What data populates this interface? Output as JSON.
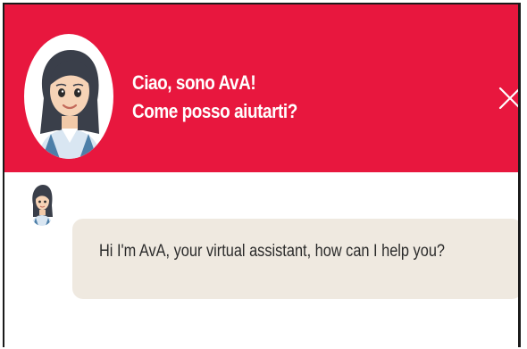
{
  "header": {
    "greeting_line1": "Ciao, sono AvA!",
    "greeting_line2": "Come posso aiutarti?",
    "background_color": "#e8173e",
    "close_icon": "close-icon"
  },
  "assistant": {
    "avatar_icon": "assistant-avatar"
  },
  "messages": [
    {
      "sender": "assistant",
      "text": "Hi I'm AvA, your virtual assistant, how can I help you?",
      "bubble_color": "#efe9e0"
    }
  ]
}
